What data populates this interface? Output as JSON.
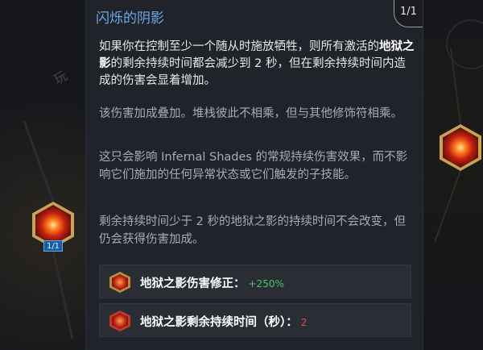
{
  "tooltip": {
    "title": "闪烁的阴影",
    "rank": "1/1",
    "desc_pre": "如果你在控制至少一个随从时施放牺牲，则所有激活的",
    "desc_key": "地狱之影",
    "desc_post": "的剩余持续时间都会减少到 2 秒，但在剩余持续时间内造成的伤害会显着增加。",
    "note1": "该伤害加成叠加。堆栈彼此不相乘，但与其他修饰符相乘。",
    "note2": "这只会影响 Infernal Shades 的常规持续伤害效果，而不影响它们施加的任何异常状态或它们触发的子技能。",
    "note3": "剩余持续时间少于 2 秒的地狱之影的持续时间不会改变，但仍会获得伤害加成。",
    "modifiers": [
      {
        "label": "地狱之影伤害修正：",
        "value": "+250%",
        "icon": "infernal-shade-damage-icon",
        "color": "#4bc46a"
      },
      {
        "label": "地狱之影剩余持续时间（秒）：",
        "value": "2",
        "icon": "infernal-shade-duration-icon",
        "color": "#e0504a"
      }
    ]
  },
  "tree": {
    "left_node_badge": "1/1"
  },
  "colors": {
    "title": "#6ba9e8",
    "panel_bg": "#20232a",
    "badge_bg": "#1d5ea3"
  }
}
